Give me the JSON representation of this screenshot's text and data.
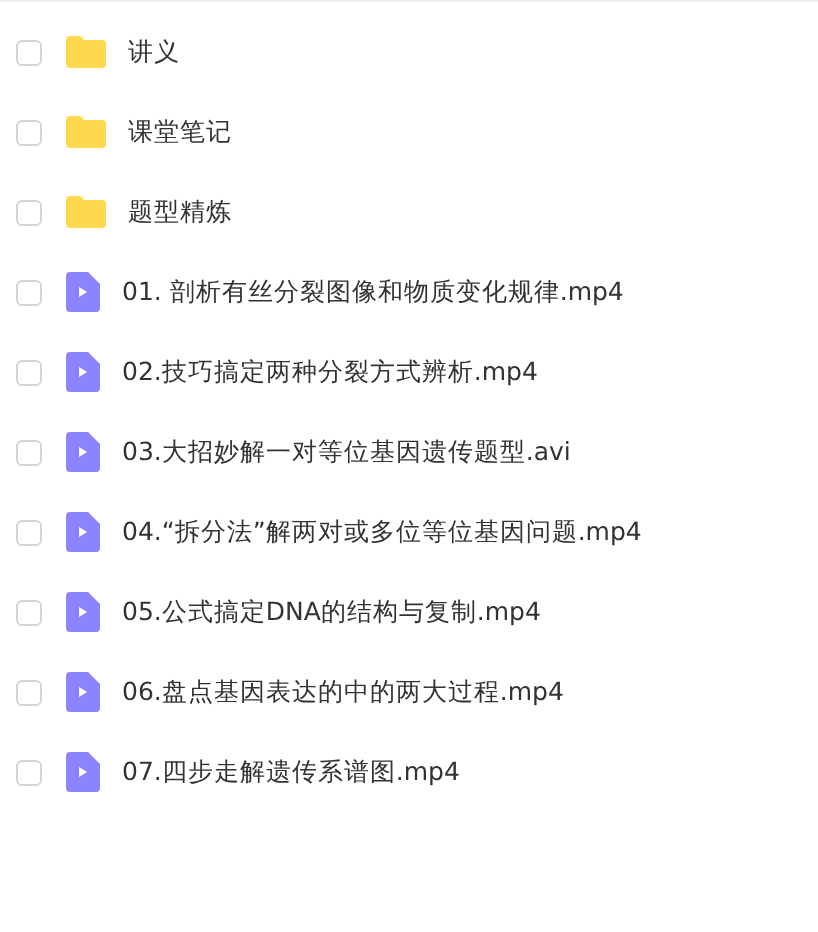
{
  "files": [
    {
      "kind": "folder",
      "name": "讲义",
      "checked": false
    },
    {
      "kind": "folder",
      "name": "课堂笔记",
      "checked": false
    },
    {
      "kind": "folder",
      "name": "题型精炼",
      "checked": false
    },
    {
      "kind": "video",
      "name": "01. 剖析有丝分裂图像和物质变化规律.mp4",
      "checked": false
    },
    {
      "kind": "video",
      "name": "02.技巧搞定两种分裂方式辨析.mp4",
      "checked": false
    },
    {
      "kind": "video",
      "name": "03.大招妙解一对等位基因遗传题型.avi",
      "checked": false
    },
    {
      "kind": "video",
      "name": "04.“拆分法”解两对或多位等位基因问题.mp4",
      "checked": false
    },
    {
      "kind": "video",
      "name": "05.公式搞定DNA的结构与复制.mp4",
      "checked": false
    },
    {
      "kind": "video",
      "name": "06.盘点基因表达的中的两大过程.mp4",
      "checked": false
    },
    {
      "kind": "video",
      "name": "07.四步走解遗传系谱图.mp4",
      "checked": false
    }
  ]
}
